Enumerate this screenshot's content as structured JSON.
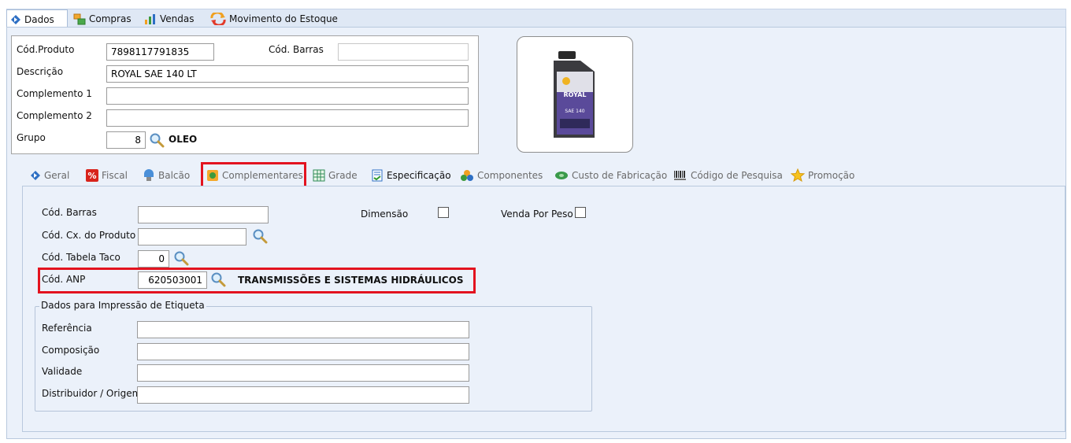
{
  "top_tabs": [
    {
      "label": "Dados",
      "icon": "diamond-nav-icon"
    },
    {
      "label": "Compras",
      "icon": "compras-icon"
    },
    {
      "label": "Vendas",
      "icon": "bar-chart-icon"
    },
    {
      "label": "Movimento do Estoque",
      "icon": "stock-movement-icon"
    }
  ],
  "product": {
    "cod_produto_label": "Cód.Produto",
    "cod_produto_value": "7898117791835",
    "cod_barras_label": "Cód. Barras",
    "cod_barras_value": "",
    "descricao_label": "Descrição",
    "descricao_value": "ROYAL SAE 140 LT",
    "complemento1_label": "Complemento 1",
    "complemento1_value": "",
    "complemento2_label": "Complemento 2",
    "complemento2_value": "",
    "grupo_label": "Grupo",
    "grupo_value": "8",
    "grupo_name": "OLEO"
  },
  "product_image": {
    "brand_text": "ROYAL",
    "grade_text": "SAE 140"
  },
  "sub_tabs": [
    {
      "label": "Geral",
      "icon": "diamond-nav-icon"
    },
    {
      "label": "Fiscal",
      "icon": "percent-icon"
    },
    {
      "label": "Balcão",
      "icon": "counter-icon"
    },
    {
      "label": "Complementares",
      "icon": "complementares-icon"
    },
    {
      "label": "Grade",
      "icon": "grid-icon"
    },
    {
      "label": "Especificação",
      "icon": "checklist-icon"
    },
    {
      "label": "Componentes",
      "icon": "components-icon"
    },
    {
      "label": "Custo de Fabricação",
      "icon": "money-icon"
    },
    {
      "label": "Código de Pesquisa",
      "icon": "barcode-icon"
    },
    {
      "label": "Promoção",
      "icon": "star-icon"
    }
  ],
  "complementares": {
    "cod_barras_label": "Cód. Barras",
    "cod_barras_value": "",
    "dimensao_label": "Dimensão",
    "venda_por_peso_label": "Venda Por Peso",
    "cod_cx_label": "Cód. Cx. do Produto",
    "cod_cx_value": "",
    "cod_tabela_taco_label": "Cód. Tabela Taco",
    "cod_tabela_taco_value": "0",
    "cod_anp_label": "Cód. ANP",
    "cod_anp_value": "620503001",
    "cod_anp_desc": "TRANSMISSÕES E SISTEMAS HIDRÁULICOS"
  },
  "etiqueta": {
    "group_title": "Dados para Impressão de Etiqueta",
    "referencia_label": "Referência",
    "referencia_value": "",
    "composicao_label": "Composição",
    "composicao_value": "",
    "validade_label": "Validade",
    "validade_value": "",
    "distribuidor_label": "Distribuidor / Origem",
    "distribuidor_value": ""
  },
  "colors": {
    "highlight": "#e3131f",
    "panel_bg": "#ebf1fa",
    "tab_bar_bg": "#dfe8f5"
  }
}
